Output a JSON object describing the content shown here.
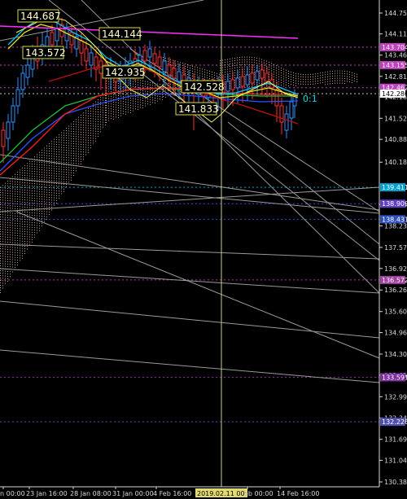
{
  "colors": {
    "background": "#000000",
    "axis": "#d8d8d8",
    "grid_dash": "#5a7a9a",
    "cursor_line": "#c8d08a",
    "magenta": "#ff2cff",
    "yellow_label_box": "#d8d84a"
  },
  "price_axis": {
    "ticks": [
      "144.750",
      "144.110",
      "143.460",
      "142.810",
      "142.180",
      "141.525",
      "140.880",
      "140.180",
      "138.880",
      "138.230",
      "137.570",
      "136.925",
      "136.265",
      "135.605",
      "134.960",
      "134.300",
      "133.655",
      "132.995",
      "132.345",
      "131.690",
      "131.045",
      "130.385"
    ]
  },
  "price_markers": [
    {
      "value": "143.704",
      "color": "#c040c0",
      "text_color": "#ffffff"
    },
    {
      "value": "143.155",
      "color": "#c040c0",
      "text_color": "#ffffff"
    },
    {
      "value": "142.462",
      "color": "#c040c0",
      "text_color": "#ffffff"
    },
    {
      "value": "142.280",
      "color": "#ffffff",
      "text_color": "#000000"
    },
    {
      "value": "139.411",
      "color": "#00a0d0",
      "text_color": "#ffffff"
    },
    {
      "value": "138.909",
      "color": "#6040c0",
      "text_color": "#ffffff"
    },
    {
      "value": "138.431",
      "color": "#3050c0",
      "text_color": "#ffffff"
    },
    {
      "value": "136.572",
      "color": "#a040a0",
      "text_color": "#ffffff"
    },
    {
      "value": "133.591",
      "color": "#8030a0",
      "text_color": "#ffffff"
    },
    {
      "value": "132.226",
      "color": "#5050b0",
      "text_color": "#ffffff"
    }
  ],
  "time_axis": {
    "labels": [
      "n 00:00",
      "23 Jan 16:00",
      "28 Jan 08:00",
      "31 Jan 00:00",
      "4 Feb 16:00",
      "2019.02.11 00:00",
      "eb 00:00",
      "14 Feb 16:00"
    ],
    "cursor_label": "2019.02.11 00:00"
  },
  "chart_labels": [
    {
      "text": "144.687"
    },
    {
      "text": "144.144"
    },
    {
      "text": "143.572"
    },
    {
      "text": "142.935"
    },
    {
      "text": "142.528"
    },
    {
      "text": "141.833"
    }
  ],
  "ratio_text": "0:1"
}
